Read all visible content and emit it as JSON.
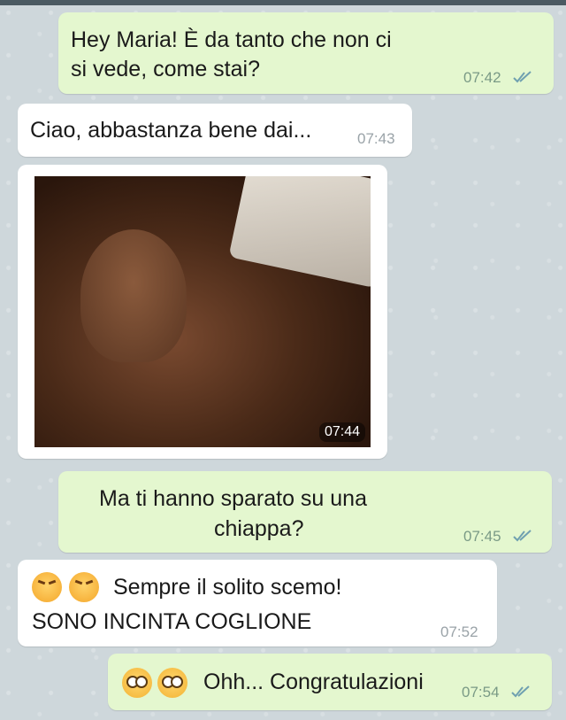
{
  "messages": [
    {
      "text_line1": "Hey Maria! È da tanto che non ci",
      "text_line2": "si vede, come stai?",
      "time": "07:42"
    },
    {
      "text": "Ciao, abbastanza bene dai...",
      "time": "07:43"
    },
    {
      "photo_time": "07:44"
    },
    {
      "text_line1": "Ma ti hanno sparato su una",
      "text_line2": "chiappa?",
      "time": "07:45"
    },
    {
      "text_line1": "Sempre il solito scemo!",
      "text_line2": "SONO INCINTA COGLIONE",
      "time": "07:52"
    },
    {
      "text": "Ohh... Congratulazioni",
      "time": "07:54"
    }
  ],
  "icons": {
    "read_ticks": "double-check-icon",
    "angry_emoji": "angry-face-emoji",
    "flushed_emoji": "flushed-face-emoji"
  },
  "colors": {
    "outgoing_bubble": "#e4f7cf",
    "incoming_bubble": "#ffffff",
    "tick_color": "#6fa0b0"
  }
}
